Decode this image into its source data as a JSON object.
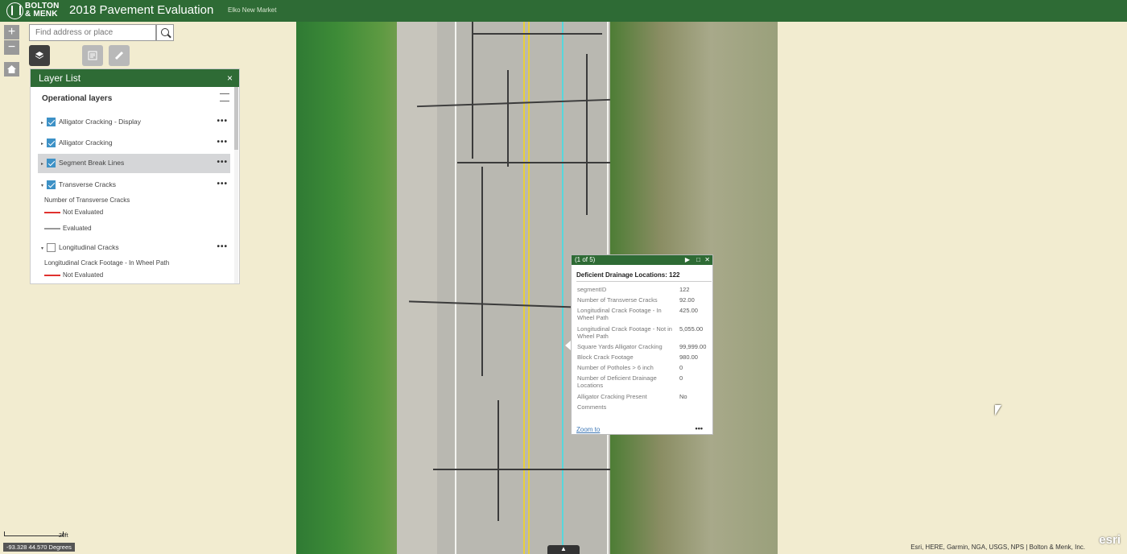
{
  "header": {
    "logo_text_line1": "BOLTON",
    "logo_text_line2": "& MENK",
    "title": "2018 Pavement Evaluation",
    "subtitle": "Elko New Market"
  },
  "search": {
    "placeholder": "Find address or place"
  },
  "layer_list": {
    "title": "Layer List",
    "close": "×",
    "section": "Operational layers",
    "layers": [
      {
        "label": "Alligator Cracking - Display",
        "checked": true
      },
      {
        "label": "Alligator Cracking",
        "checked": true
      },
      {
        "label": "Segment Break Lines",
        "checked": true,
        "selected": true
      },
      {
        "label": "Transverse Cracks",
        "checked": true,
        "legend_title": "Number of Transverse Cracks",
        "legend": [
          "Not Evaluated",
          "Evaluated"
        ]
      },
      {
        "label": "Longitudinal Cracks",
        "checked": false,
        "legend_title": "Longitudinal Crack Footage - In Wheel Path",
        "legend": [
          "Not Evaluated"
        ]
      }
    ],
    "more": "•••"
  },
  "popup": {
    "counter": "(1 of 5)",
    "title": "Deficient Drainage Locations: 122",
    "attributes": [
      {
        "key": "segmentID",
        "value": "122"
      },
      {
        "key": "Number of Transverse Cracks",
        "value": "92.00"
      },
      {
        "key": "Longitudinal Crack Footage - In Wheel Path",
        "value": "425.00"
      },
      {
        "key": "Longitudinal Crack Footage - Not in Wheel Path",
        "value": "5,055.00"
      },
      {
        "key": "Square Yards Alligator Cracking",
        "value": "99,999.00"
      },
      {
        "key": "Block Crack Footage",
        "value": "980.00"
      },
      {
        "key": "Number of Potholes > 6 inch",
        "value": "0"
      },
      {
        "key": "Number of Deficient Drainage Locations",
        "value": "0"
      },
      {
        "key": "Alligator Cracking Present",
        "value": "No"
      },
      {
        "key": "Comments",
        "value": ""
      }
    ],
    "zoom_to": "Zoom to",
    "more": "•••"
  },
  "footer": {
    "scale_label": "20ft",
    "coordinates": "-93.328 44.570 Degrees",
    "attribution": "Esri, HERE, Garmin, NGA, USGS, NPS | Bolton & Menk, Inc.",
    "esri_logo": "esri"
  },
  "colors": {
    "header": "#2e6b35",
    "checkbox": "#3d91c6",
    "not_evaluated": "#e0312f",
    "evaluated": "#999999"
  }
}
